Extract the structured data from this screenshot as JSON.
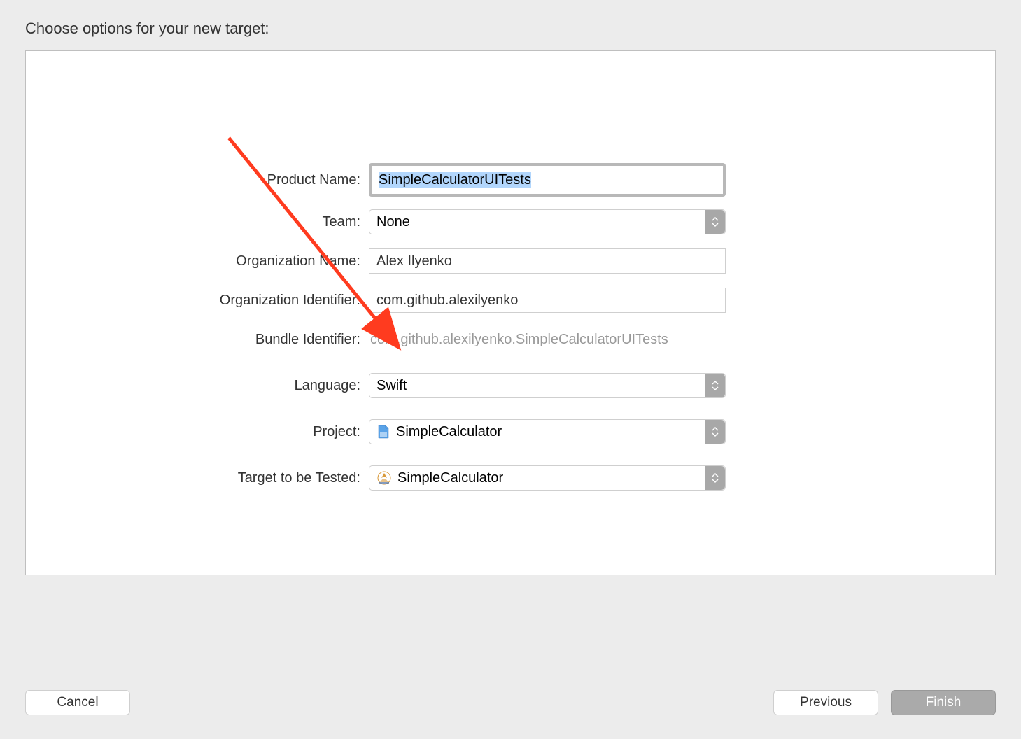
{
  "dialogTitle": "Choose options for your new target:",
  "form": {
    "productName": {
      "label": "Product Name:",
      "value": "SimpleCalculatorUITests"
    },
    "team": {
      "label": "Team:",
      "value": "None"
    },
    "orgName": {
      "label": "Organization Name:",
      "value": "Alex Ilyenko"
    },
    "orgIdentifier": {
      "label": "Organization Identifier:",
      "value": "com.github.alexilyenko"
    },
    "bundleIdentifier": {
      "label": "Bundle Identifier:",
      "value": "com.github.alexilyenko.SimpleCalculatorUITests"
    },
    "language": {
      "label": "Language:",
      "value": "Swift"
    },
    "project": {
      "label": "Project:",
      "value": "SimpleCalculator"
    },
    "targetToBeTested": {
      "label": "Target to be Tested:",
      "value": "SimpleCalculator"
    }
  },
  "buttons": {
    "cancel": "Cancel",
    "previous": "Previous",
    "finish": "Finish"
  }
}
